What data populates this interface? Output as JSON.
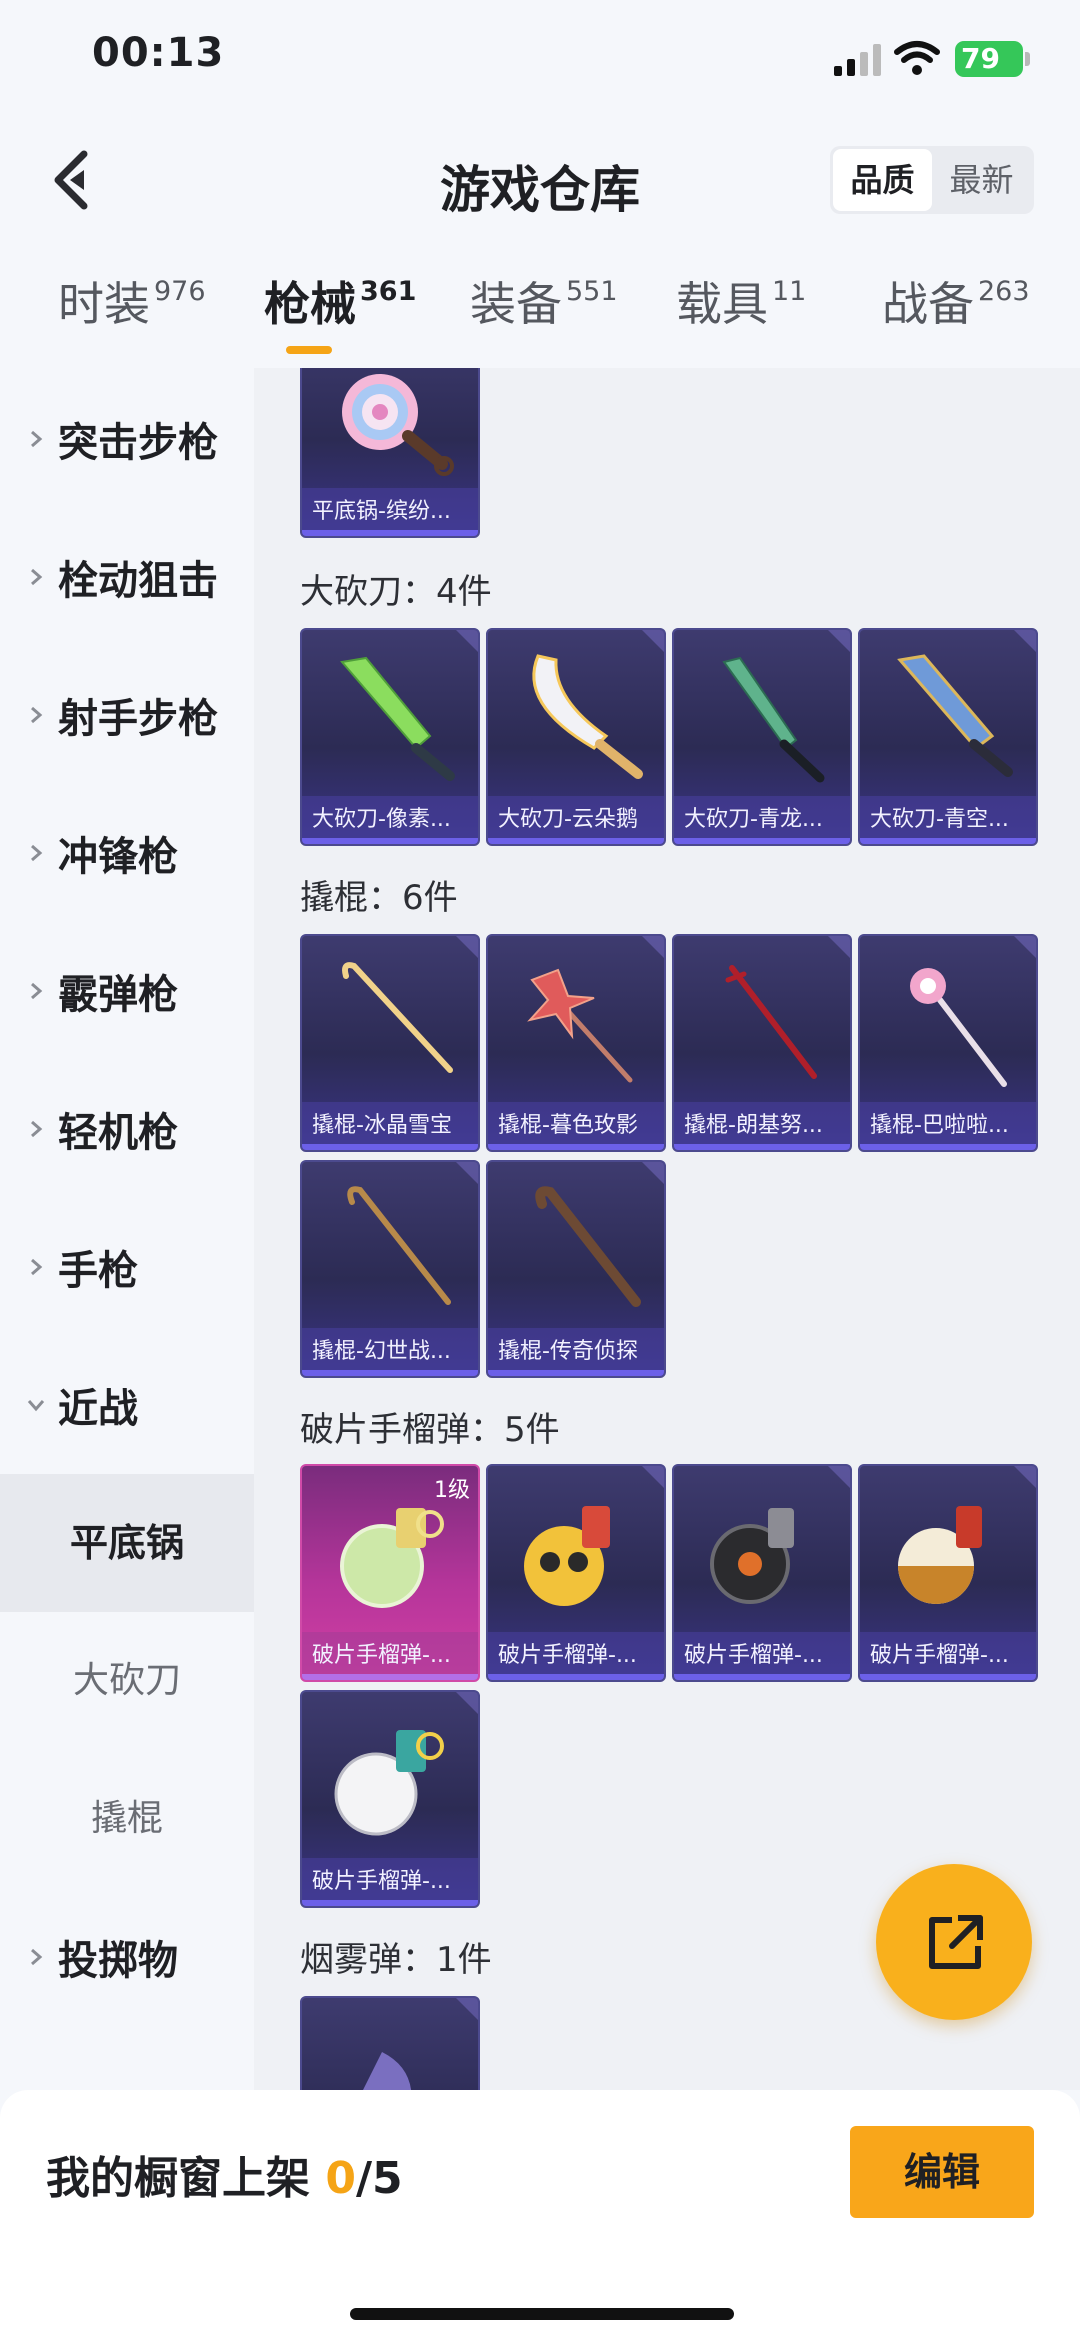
{
  "status_bar": {
    "time": "00:13",
    "battery": "79"
  },
  "header": {
    "title": "游戏仓库",
    "sort_options": [
      "品质",
      "最新"
    ],
    "active_sort": "品质"
  },
  "tabs": [
    {
      "label": "时装",
      "count": "976"
    },
    {
      "label": "枪械",
      "count": "361"
    },
    {
      "label": "装备",
      "count": "551"
    },
    {
      "label": "载具",
      "count": "11"
    },
    {
      "label": "战备",
      "count": "263"
    }
  ],
  "active_tab": "枪械",
  "sidebar": {
    "categories": [
      "突击步枪",
      "栓动狙击",
      "射手步枪",
      "冲锋枪",
      "霰弹枪",
      "轻机枪",
      "手枪",
      "近战"
    ],
    "melee_sub": [
      "平底锅",
      "大砍刀",
      "撬棍"
    ],
    "active_sub": "平底锅",
    "last": "投掷物"
  },
  "sections": {
    "pan": {
      "items": [
        "平底锅-缤纷..."
      ]
    },
    "machete": {
      "title": "大砍刀：4件",
      "items": [
        "大砍刀-像素...",
        "大砍刀-云朵鹅",
        "大砍刀-青龙...",
        "大砍刀-青空..."
      ]
    },
    "crowbar": {
      "title": "撬棍：6件",
      "items": [
        "撬棍-冰晶雪宝",
        "撬棍-暮色玫影",
        "撬棍-朗基努...",
        "撬棍-巴啦啦...",
        "撬棍-幻世战...",
        "撬棍-传奇侦探"
      ]
    },
    "grenade": {
      "title": "破片手榴弹：5件",
      "level_badge": "1级",
      "items": [
        "破片手榴弹-...",
        "破片手榴弹-...",
        "破片手榴弹-...",
        "破片手榴弹-...",
        "破片手榴弹-..."
      ]
    },
    "smoke": {
      "title": "烟雾弹：1件"
    }
  },
  "bottom": {
    "label": "我的橱窗上架 ",
    "count": "0",
    "total": "/5",
    "edit": "编辑"
  },
  "colors": {
    "accent": "#f9a61a",
    "card_purple": "#2c2b54",
    "card_pink": "#b5359a"
  }
}
